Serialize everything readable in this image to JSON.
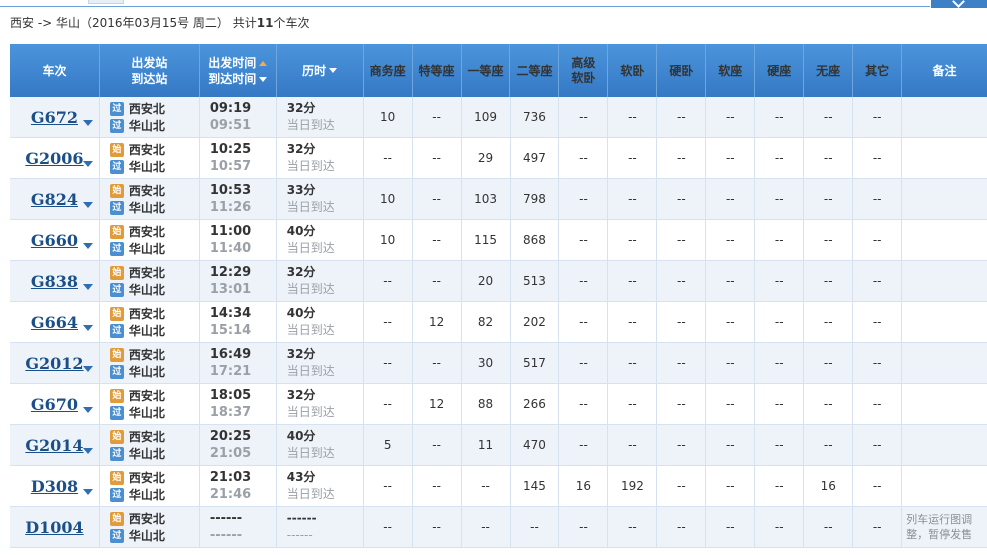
{
  "summary": {
    "route": "西安 -> 华山（2016年03月15号  周二）",
    "count_prefix": "共计",
    "count": "11",
    "count_suffix": "个车次"
  },
  "header": {
    "train": "车次",
    "stations_dep": "出发站",
    "stations_arr": "到达站",
    "time_dep": "出发时间",
    "time_arr": "到达时间",
    "duration": "历时",
    "seats": [
      "商务座",
      "特等座",
      "一等座",
      "二等座",
      "高级软卧",
      "软卧",
      "硬卧",
      "软座",
      "硬座",
      "无座",
      "其它"
    ],
    "note": "备注"
  },
  "rows": [
    {
      "train": "G672",
      "badge1": "过",
      "b1type": "pass",
      "from": "西安北",
      "badge2": "过",
      "to": "华山北",
      "dep": "09:19",
      "arr": "09:51",
      "dur": "32分",
      "day": "当日到达",
      "seats": [
        "10",
        "--",
        "109",
        "736",
        "--",
        "--",
        "--",
        "--",
        "--",
        "--",
        "--"
      ],
      "note": ""
    },
    {
      "train": "G2006",
      "badge1": "始",
      "b1type": "start",
      "from": "西安北",
      "badge2": "过",
      "to": "华山北",
      "dep": "10:25",
      "arr": "10:57",
      "dur": "32分",
      "day": "当日到达",
      "seats": [
        "--",
        "--",
        "29",
        "497",
        "--",
        "--",
        "--",
        "--",
        "--",
        "--",
        "--"
      ],
      "note": ""
    },
    {
      "train": "G824",
      "badge1": "始",
      "b1type": "start",
      "from": "西安北",
      "badge2": "过",
      "to": "华山北",
      "dep": "10:53",
      "arr": "11:26",
      "dur": "33分",
      "day": "当日到达",
      "seats": [
        "10",
        "--",
        "103",
        "798",
        "--",
        "--",
        "--",
        "--",
        "--",
        "--",
        "--"
      ],
      "note": ""
    },
    {
      "train": "G660",
      "badge1": "始",
      "b1type": "start",
      "from": "西安北",
      "badge2": "过",
      "to": "华山北",
      "dep": "11:00",
      "arr": "11:40",
      "dur": "40分",
      "day": "当日到达",
      "seats": [
        "10",
        "--",
        "115",
        "868",
        "--",
        "--",
        "--",
        "--",
        "--",
        "--",
        "--"
      ],
      "note": ""
    },
    {
      "train": "G838",
      "badge1": "始",
      "b1type": "start",
      "from": "西安北",
      "badge2": "过",
      "to": "华山北",
      "dep": "12:29",
      "arr": "13:01",
      "dur": "32分",
      "day": "当日到达",
      "seats": [
        "--",
        "--",
        "20",
        "513",
        "--",
        "--",
        "--",
        "--",
        "--",
        "--",
        "--"
      ],
      "note": ""
    },
    {
      "train": "G664",
      "badge1": "始",
      "b1type": "start",
      "from": "西安北",
      "badge2": "过",
      "to": "华山北",
      "dep": "14:34",
      "arr": "15:14",
      "dur": "40分",
      "day": "当日到达",
      "seats": [
        "--",
        "12",
        "82",
        "202",
        "--",
        "--",
        "--",
        "--",
        "--",
        "--",
        "--"
      ],
      "note": ""
    },
    {
      "train": "G2012",
      "badge1": "始",
      "b1type": "start",
      "from": "西安北",
      "badge2": "过",
      "to": "华山北",
      "dep": "16:49",
      "arr": "17:21",
      "dur": "32分",
      "day": "当日到达",
      "seats": [
        "--",
        "--",
        "30",
        "517",
        "--",
        "--",
        "--",
        "--",
        "--",
        "--",
        "--"
      ],
      "note": ""
    },
    {
      "train": "G670",
      "badge1": "始",
      "b1type": "start",
      "from": "西安北",
      "badge2": "过",
      "to": "华山北",
      "dep": "18:05",
      "arr": "18:37",
      "dur": "32分",
      "day": "当日到达",
      "seats": [
        "--",
        "12",
        "88",
        "266",
        "--",
        "--",
        "--",
        "--",
        "--",
        "--",
        "--"
      ],
      "note": ""
    },
    {
      "train": "G2014",
      "badge1": "始",
      "b1type": "start",
      "from": "西安北",
      "badge2": "过",
      "to": "华山北",
      "dep": "20:25",
      "arr": "21:05",
      "dur": "40分",
      "day": "当日到达",
      "seats": [
        "5",
        "--",
        "11",
        "470",
        "--",
        "--",
        "--",
        "--",
        "--",
        "--",
        "--"
      ],
      "note": ""
    },
    {
      "train": "D308",
      "badge1": "始",
      "b1type": "start",
      "from": "西安北",
      "badge2": "过",
      "to": "华山北",
      "dep": "21:03",
      "arr": "21:46",
      "dur": "43分",
      "day": "当日到达",
      "seats": [
        "--",
        "--",
        "--",
        "145",
        "16",
        "192",
        "--",
        "--",
        "--",
        "16",
        "--"
      ],
      "note": ""
    },
    {
      "train": "D1004",
      "badge1": "始",
      "b1type": "start",
      "from": "西安北",
      "badge2": "过",
      "to": "华山北",
      "dep": "------",
      "arr": "------",
      "dur": "------",
      "day": "------",
      "seats": [
        "--",
        "--",
        "--",
        "--",
        "--",
        "--",
        "--",
        "--",
        "--",
        "--",
        "--"
      ],
      "note": "列车运行图调整，暂停发售"
    }
  ]
}
